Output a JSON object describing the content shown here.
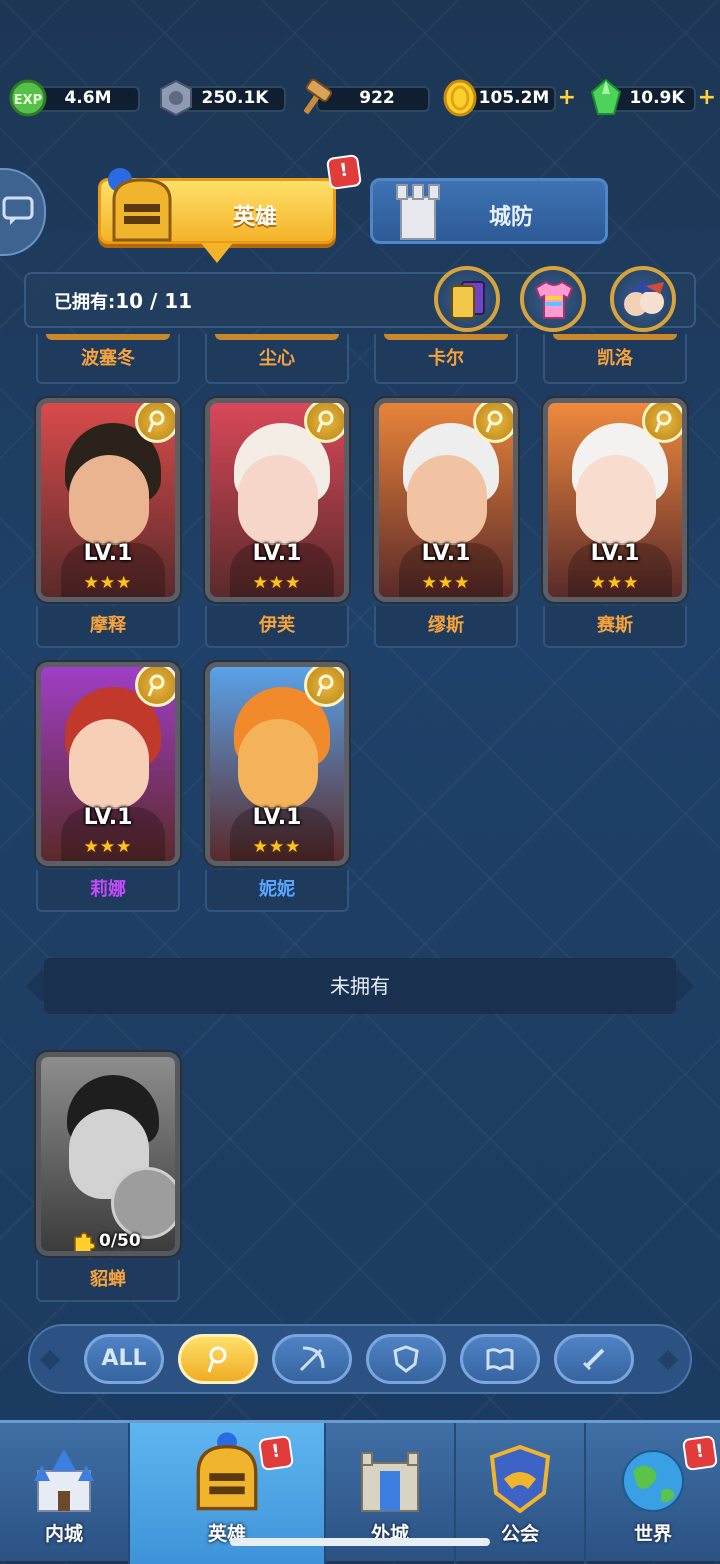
{
  "resources": [
    {
      "name": "exp-crystal",
      "value": "4.6M"
    },
    {
      "name": "stone-emblem",
      "value": "250.1K"
    },
    {
      "name": "hammer",
      "value": "922"
    },
    {
      "name": "gold-coin",
      "value": "105.2M"
    },
    {
      "name": "gem",
      "value": "10.9K"
    }
  ],
  "tabs": {
    "hero": "英雄",
    "defense": "城防",
    "hero_badge": "!"
  },
  "owned": {
    "label": "已拥有:",
    "count": "10 / 11"
  },
  "partial_heroes": [
    "波塞冬",
    "尘心",
    "卡尔",
    "凯洛"
  ],
  "heroes": [
    {
      "name": "摩释",
      "level": "LV.1",
      "stars": "★★★",
      "name_color": "#f7a33a",
      "bg": "#d94b4b",
      "skin": "#e9b48f",
      "hair": "#2b221c"
    },
    {
      "name": "伊芙",
      "level": "LV.1",
      "stars": "★★★",
      "name_color": "#f7a33a",
      "bg": "#d9485a",
      "skin": "#f6d6c9",
      "hair": "#f3ede6"
    },
    {
      "name": "缪斯",
      "level": "LV.1",
      "stars": "★★★",
      "name_color": "#f7a33a",
      "bg": "#e8843a",
      "skin": "#f2c3a3",
      "hair": "#eeeeee"
    },
    {
      "name": "赛斯",
      "level": "LV.1",
      "stars": "★★★",
      "name_color": "#f7a33a",
      "bg": "#ef8a3e",
      "skin": "#f8dccd",
      "hair": "#f4f2f0"
    },
    {
      "name": "莉娜",
      "level": "LV.1",
      "stars": "★★★",
      "name_color": "#c64bff",
      "bg": "#a03ec6",
      "skin": "#f7cfb6",
      "hair": "#c0392b"
    },
    {
      "name": "妮妮",
      "level": "LV.1",
      "stars": "★★★",
      "name_color": "#5aa6ff",
      "bg": "#5aa2e8",
      "skin": "#f4b35a",
      "hair": "#f08a2a"
    }
  ],
  "section_unowned": "未拥有",
  "locked_hero": {
    "name": "貂蝉",
    "progress": "0/50"
  },
  "filters": [
    "ALL",
    "mage",
    "archer",
    "tank",
    "support",
    "warrior"
  ],
  "nav": [
    {
      "label": "内城",
      "badge": ""
    },
    {
      "label": "英雄",
      "badge": "!"
    },
    {
      "label": "外城",
      "badge": ""
    },
    {
      "label": "公会",
      "badge": ""
    },
    {
      "label": "世界",
      "badge": "!"
    }
  ],
  "colors": {
    "accent": "#f4b329",
    "name_orange": "#f7a33a",
    "bg": "#1f4068"
  }
}
